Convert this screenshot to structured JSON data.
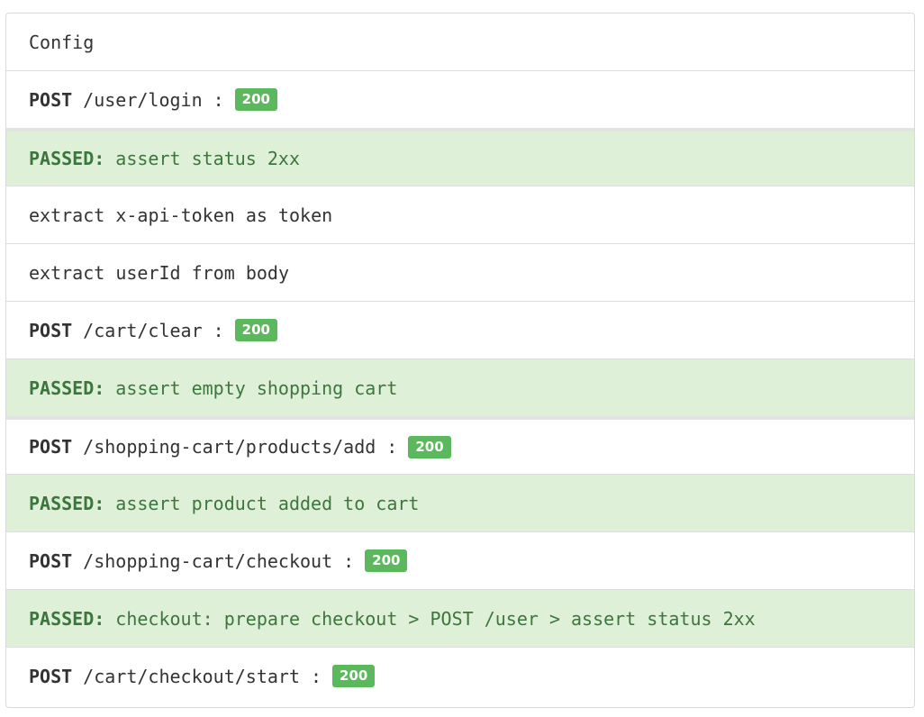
{
  "rows": [
    {
      "type": "text",
      "text": "Config"
    },
    {
      "type": "request",
      "method": "POST",
      "path": "/user/login",
      "colon": ":",
      "status": "200"
    },
    {
      "type": "passed",
      "label": "PASSED:",
      "text": "assert status 2xx"
    },
    {
      "type": "text",
      "text": "extract x-api-token as token"
    },
    {
      "type": "text",
      "text": "extract userId from body"
    },
    {
      "type": "request",
      "method": "POST",
      "path": "/cart/clear",
      "colon": ":",
      "status": "200"
    },
    {
      "type": "passed",
      "label": "PASSED:",
      "text": "assert empty shopping cart"
    },
    {
      "type": "request",
      "method": "POST",
      "path": "/shopping-cart/products/add",
      "colon": ":",
      "status": "200"
    },
    {
      "type": "passed",
      "label": "PASSED:",
      "text": "assert product added to cart"
    },
    {
      "type": "request",
      "method": "POST",
      "path": "/shopping-cart/checkout",
      "colon": ":",
      "status": "200"
    },
    {
      "type": "passed",
      "label": "PASSED:",
      "text": "checkout: prepare checkout > POST /user > assert status 2xx"
    },
    {
      "type": "request",
      "method": "POST",
      "path": "/cart/checkout/start",
      "colon": ":",
      "status": "200"
    }
  ],
  "colors": {
    "passed_bg": "#dff0d8",
    "passed_text": "#3c763d",
    "badge_bg": "#5cb85c"
  }
}
